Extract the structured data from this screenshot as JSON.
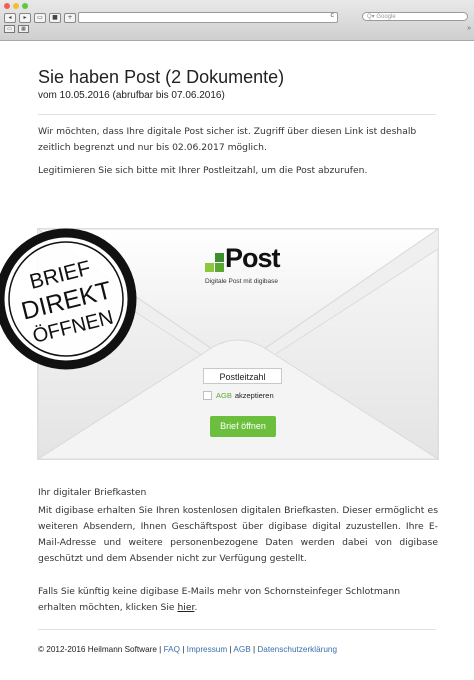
{
  "browser": {
    "search_placeholder": "Q▾ Google",
    "nav_back": "◂",
    "nav_forward": "▸",
    "reload": "c"
  },
  "header": {
    "title": "Sie haben Post (2 Dokumente)",
    "subtitle": "vom 10.05.2016 (abrufbar bis 07.06.2016)"
  },
  "intro": {
    "para1": "Wir möchten, dass Ihre digitale Post sicher ist. Zugriff über diesen Link ist deshalb zeitlich begrenzt und nur bis 02.06.2017 möglich.",
    "para2": "Legitimieren Sie sich bitte mit Ihrer Postleitzahl, um die Post abzurufen."
  },
  "stamp": {
    "line1": "BRIEF",
    "line2": "DIREKT",
    "line3": "ÖFFNEN"
  },
  "envelope": {
    "logo_text": "Post",
    "logo_sub": "Digitale Post mit digibase",
    "postcode_placeholder": "Postleitzahl",
    "agb_link": "AGB",
    "agb_suffix": "akzeptieren",
    "open_button": "Brief öffnen",
    "logo_colors": [
      "#8dc63f",
      "#5aa832",
      "#3c8f2c"
    ]
  },
  "mailbox": {
    "heading": "Ihr digitaler Briefkasten",
    "para": "Mit digibase erhalten Sie Ihren kostenlosen digitalen Briefkasten. Dieser ermöglicht es weiteren Absendern, Ihnen Geschäftspost über digibase digital zuzustellen. Ihre E-Mail-Adresse und weitere personenbezogene Daten werden dabei von digibase geschützt und dem Absender nicht zur Verfügung gestellt.",
    "unsub_text": "Falls Sie künftig keine digibase E-Mails mehr von Schornsteinfeger Schlotmann erhalten möchten, klicken Sie ",
    "unsub_link": "hier",
    "unsub_end": "."
  },
  "footer": {
    "copyright": "© 2012-2016 Heilmann Software | ",
    "links": [
      "FAQ",
      "Impressum",
      "AGB",
      "Datenschutzerklärung"
    ],
    "separator": " | "
  }
}
